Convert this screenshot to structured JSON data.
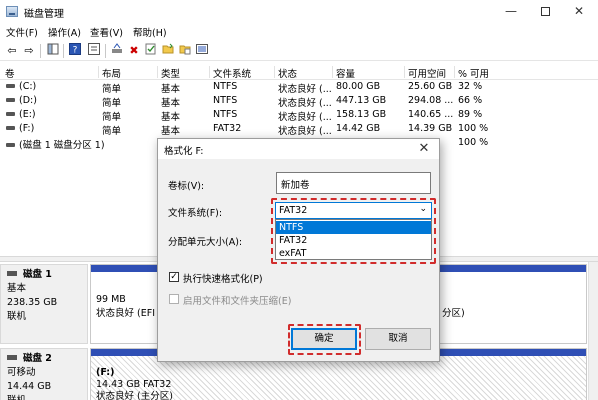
{
  "window": {
    "title": "磁盘管理",
    "minimize_glyph": "—",
    "close_glyph": "✕"
  },
  "menu": [
    "文件(F)",
    "操作(A)",
    "查看(V)",
    "帮助(H)"
  ],
  "toolbar_glyphs": {
    "back": "⇦",
    "forward": "⇨",
    "refresh": "⟳",
    "delete": "✖"
  },
  "volume_table": {
    "columns": [
      "卷",
      "布局",
      "类型",
      "文件系统",
      "状态",
      "容量",
      "可用空间",
      "% 可用"
    ],
    "rows": [
      {
        "volume": "(C:)",
        "layout": "简单",
        "type": "基本",
        "fs": "NTFS",
        "status": "状态良好 (...",
        "capacity": "80.00 GB",
        "free": "25.60 GB",
        "pct": "32 %"
      },
      {
        "volume": "(D:)",
        "layout": "简单",
        "type": "基本",
        "fs": "NTFS",
        "status": "状态良好 (...",
        "capacity": "447.13 GB",
        "free": "294.08 ...",
        "pct": "66 %"
      },
      {
        "volume": "(E:)",
        "layout": "简单",
        "type": "基本",
        "fs": "NTFS",
        "status": "状态良好 (...",
        "capacity": "158.13 GB",
        "free": "140.65 ...",
        "pct": "89 %"
      },
      {
        "volume": "(F:)",
        "layout": "简单",
        "type": "基本",
        "fs": "FAT32",
        "status": "状态良好 (...",
        "capacity": "14.42 GB",
        "free": "14.39 GB",
        "pct": "100 %"
      },
      {
        "volume": "(磁盘 1 磁盘分区 1)",
        "layout": "",
        "type": "",
        "fs": "",
        "status": "",
        "capacity": "",
        "free": "",
        "pct": "100 %"
      }
    ]
  },
  "disks": [
    {
      "name": "磁盘 1",
      "type": "基本",
      "size": "238.35 GB",
      "state": "联机",
      "part_size": "99 MB",
      "part_status": "状态良好 (EFI 系统",
      "right_tail": "分区)"
    },
    {
      "name": "磁盘 2",
      "type": "可移动",
      "size": "14.44 GB",
      "state": "联机",
      "part_name": "(F:)",
      "part_size": "14.43 GB FAT32",
      "part_status": "状态良好 (主分区)"
    }
  ],
  "dialog": {
    "title": "格式化 F:",
    "close_glyph": "✕",
    "label_volume": "卷标(V):",
    "volume_value": "新加卷",
    "label_fs": "文件系统(F):",
    "fs_selected": "FAT32",
    "fs_options": [
      "NTFS",
      "FAT32",
      "exFAT"
    ],
    "fs_highlight": "NTFS",
    "label_alloc": "分配单元大小(A):",
    "quick_format": "执行快速格式化(P)",
    "quick_format_checked": true,
    "compress": "启用文件和文件夹压缩(E)",
    "compress_checked": false,
    "ok": "确定",
    "cancel": "取消"
  },
  "colors": {
    "highlight_red": "#d12c2c",
    "selection_blue": "#0078d7",
    "partition_bar": "#2f4fb5"
  }
}
